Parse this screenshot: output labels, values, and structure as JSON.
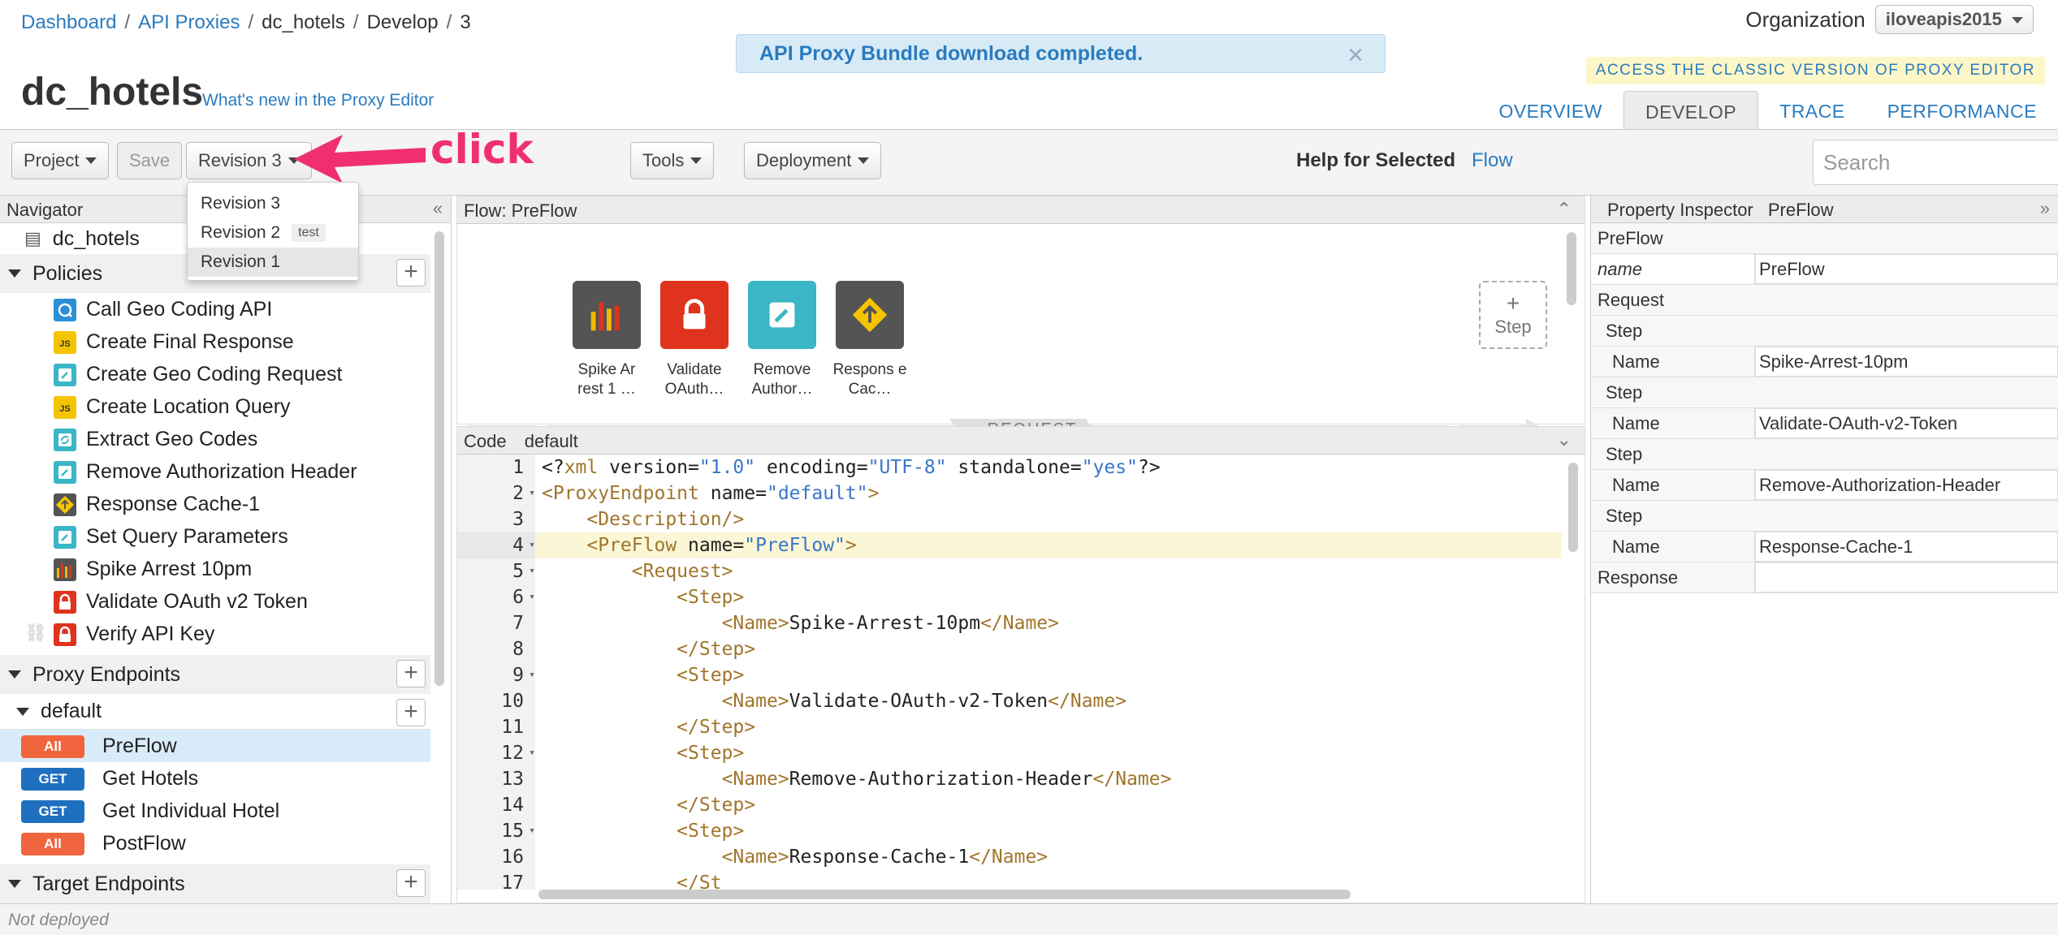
{
  "breadcrumb": [
    "Dashboard",
    "API Proxies",
    "dc_hotels",
    "Develop",
    "3"
  ],
  "organization": {
    "label": "Organization",
    "value": "iloveapis2015"
  },
  "notice": "API Proxy Bundle download completed.",
  "classic_link": "ACCESS THE CLASSIC VERSION OF PROXY EDITOR",
  "page_title": "dc_hotels",
  "whats_new": "What's new in the Proxy Editor",
  "tabs": [
    "OVERVIEW",
    "DEVELOP",
    "TRACE",
    "PERFORMANCE"
  ],
  "toolbar": {
    "project": "Project",
    "save": "Save",
    "revision": "Revision 3",
    "tools": "Tools",
    "deployment": "Deployment",
    "help_label": "Help for Selected",
    "help_link": "Flow",
    "search_placeholder": "Search"
  },
  "callout": "click",
  "revision_menu": [
    {
      "label": "Revision 3",
      "badge": ""
    },
    {
      "label": "Revision 2",
      "badge": "test"
    },
    {
      "label": "Revision 1",
      "badge": ""
    }
  ],
  "navigator": {
    "title": "Navigator",
    "proxy_name": "dc_hotels",
    "policies_label": "Policies",
    "policies": [
      {
        "name": "Call Geo Coding API",
        "icon": "callout-icon"
      },
      {
        "name": "Create Final Response",
        "icon": "javascript-icon"
      },
      {
        "name": "Create Geo Coding Request",
        "icon": "assign-message-icon"
      },
      {
        "name": "Create Location Query",
        "icon": "javascript-icon"
      },
      {
        "name": "Extract Geo Codes",
        "icon": "extract-variables-icon"
      },
      {
        "name": "Remove Authorization Header",
        "icon": "assign-message-icon"
      },
      {
        "name": "Response Cache-1",
        "icon": "response-cache-icon"
      },
      {
        "name": "Set Query Parameters",
        "icon": "assign-message-icon"
      },
      {
        "name": "Spike Arrest 10pm",
        "icon": "spike-arrest-icon"
      },
      {
        "name": "Validate OAuth v2 Token",
        "icon": "lock-icon"
      },
      {
        "name": "Verify API Key",
        "icon": "lock-icon"
      }
    ],
    "proxy_endpoints_label": "Proxy Endpoints",
    "default_label": "default",
    "flows": [
      {
        "verb": "All",
        "name": "PreFlow"
      },
      {
        "verb": "GET",
        "name": "Get Hotels"
      },
      {
        "verb": "GET",
        "name": "Get Individual Hotel"
      },
      {
        "verb": "All",
        "name": "PostFlow"
      }
    ],
    "target_endpoints_label": "Target Endpoints"
  },
  "flow_panel": {
    "title": "Flow: PreFlow",
    "steps": [
      {
        "label": "Spike Ar rest 1 …",
        "icon": "spike-arrest-icon",
        "color": "#545454"
      },
      {
        "label": "Validate OAuth…",
        "icon": "lock-icon",
        "color": "#e0331d"
      },
      {
        "label": "Remove Author…",
        "icon": "assign-message-icon",
        "color": "#3ab6c6"
      },
      {
        "label": "Respons e Cac…",
        "icon": "response-cache-icon",
        "color": "#545454"
      }
    ],
    "add_step": "Step",
    "request_label": "REQUEST"
  },
  "code_panel": {
    "title": "Code",
    "name": "default",
    "line_numbers": [
      "1",
      "2",
      "3",
      "4",
      "5",
      "6",
      "7",
      "8",
      "9",
      "10",
      "11",
      "12",
      "13",
      "14",
      "15",
      "16",
      "17"
    ]
  },
  "inspector": {
    "title": "Property Inspector",
    "subject": "PreFlow",
    "rows": [
      {
        "k": "PreFlow",
        "v": "",
        "indent": 0
      },
      {
        "k": "name",
        "v": "PreFlow",
        "indent": 0,
        "italic": true
      },
      {
        "k": "Request",
        "v": "",
        "indent": 1
      },
      {
        "k": "Step",
        "v": "",
        "indent": 2
      },
      {
        "k": "Name",
        "v": "Spike-Arrest-10pm",
        "indent": 3
      },
      {
        "k": "Step",
        "v": "",
        "indent": 2
      },
      {
        "k": "Name",
        "v": "Validate-OAuth-v2-Token",
        "indent": 3
      },
      {
        "k": "Step",
        "v": "",
        "indent": 2
      },
      {
        "k": "Name",
        "v": "Remove-Authorization-Header",
        "indent": 3
      },
      {
        "k": "Step",
        "v": "",
        "indent": 2
      },
      {
        "k": "Name",
        "v": "Response-Cache-1",
        "indent": 3
      },
      {
        "k": "Response",
        "v": "",
        "indent": 1
      }
    ]
  },
  "status": "Not deployed",
  "colors": {
    "accent": "#2a7bbf",
    "callout": "#f0306e",
    "verb_all": "#f0653e",
    "verb_get": "#1f6fbf"
  }
}
